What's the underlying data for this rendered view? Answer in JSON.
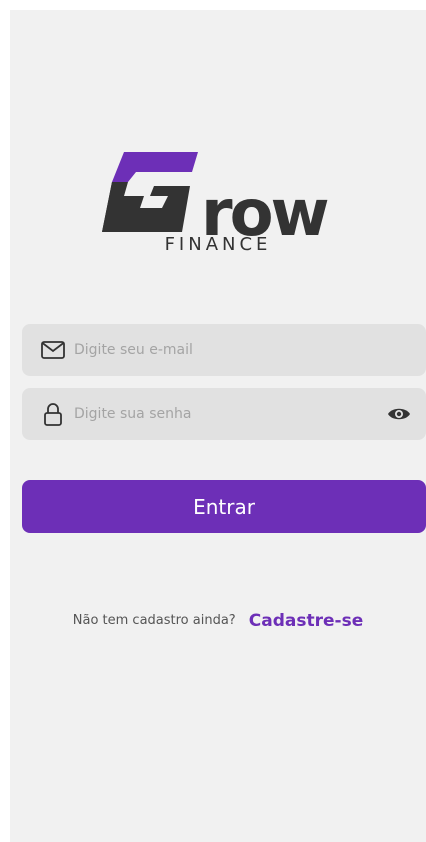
{
  "brand": {
    "wordmark": "row",
    "subtitle": "FINANCE",
    "accent_color": "#6d2fb7",
    "dark_color": "#333333"
  },
  "form": {
    "email": {
      "placeholder": "Digite seu e-mail",
      "value": "",
      "icon": "envelope-icon"
    },
    "password": {
      "placeholder": "Digite sua senha",
      "value": "",
      "icon": "lock-icon",
      "toggle_icon": "eye-icon"
    },
    "submit_label": "Entrar"
  },
  "signup": {
    "prompt": "Não tem cadastro ainda?",
    "link_label": "Cadastre-se"
  }
}
